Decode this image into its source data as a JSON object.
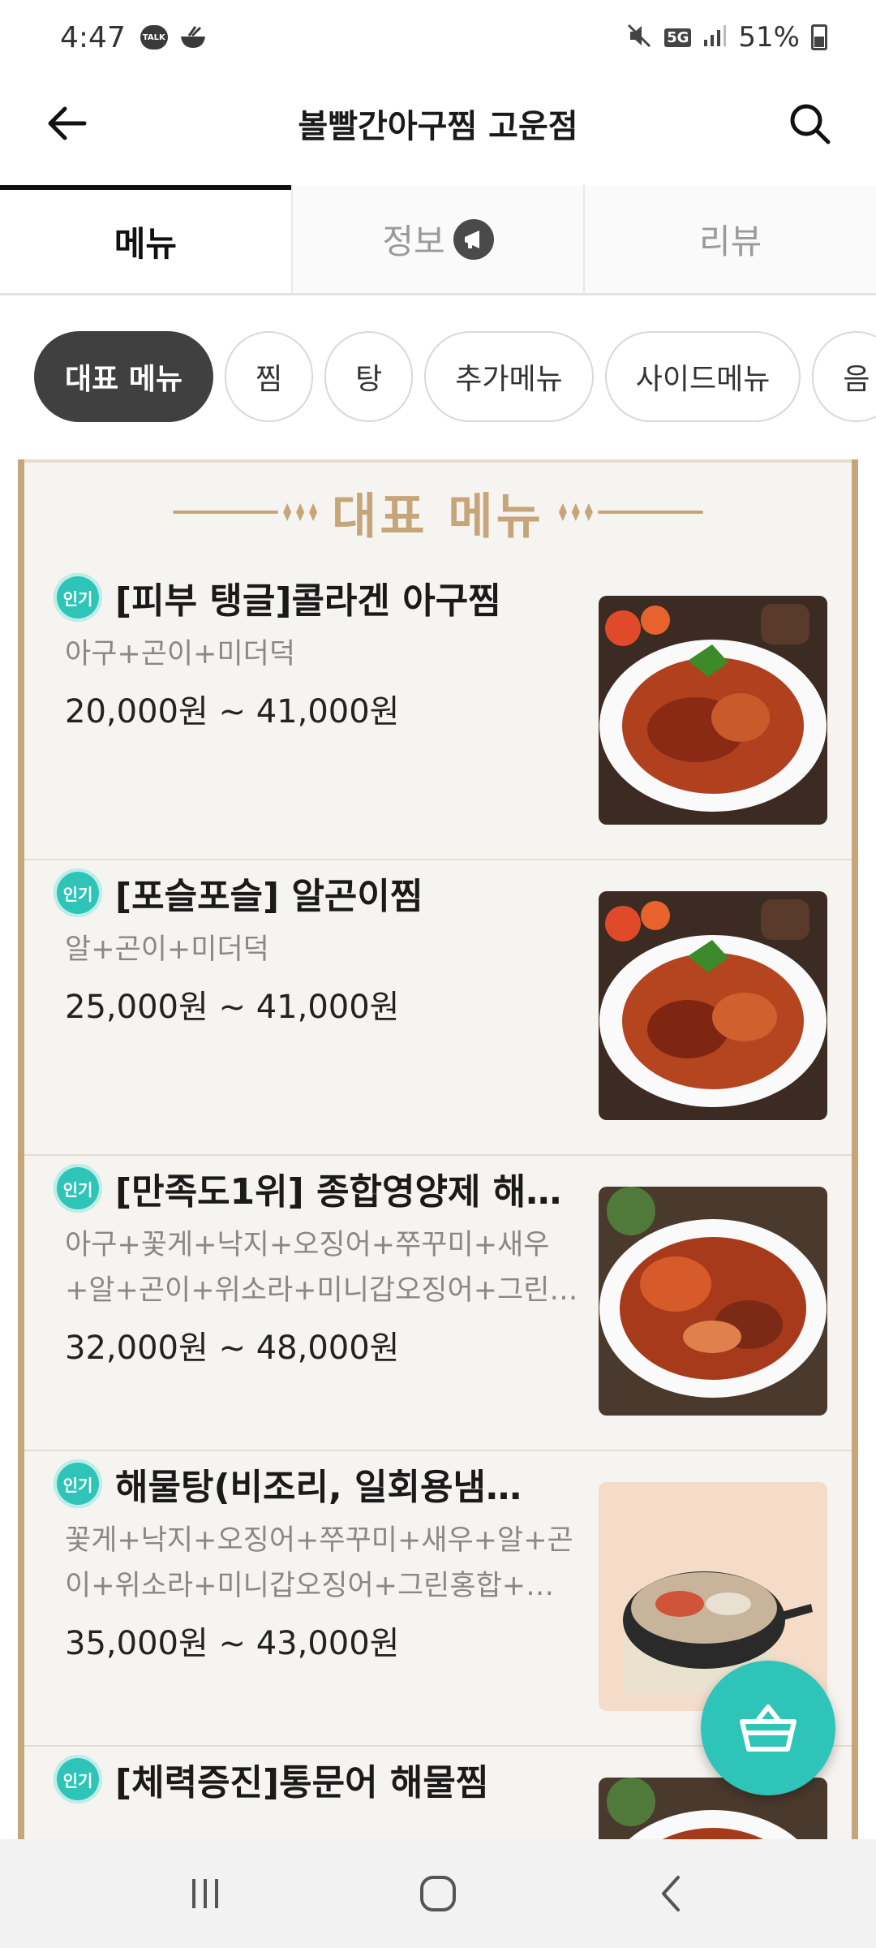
{
  "status_bar": {
    "time": "4:47",
    "talk_icon_text": "TALK",
    "battery_percent": "51%",
    "network": "5G"
  },
  "app_bar": {
    "title": "볼빨간아구찜 고운점"
  },
  "tabs": [
    {
      "label": "메뉴",
      "active": true
    },
    {
      "label": "정보",
      "active": false
    },
    {
      "label": "리뷰",
      "active": false
    }
  ],
  "chips": [
    {
      "label": "대표 메뉴",
      "active": true
    },
    {
      "label": "찜",
      "active": false
    },
    {
      "label": "탕",
      "active": false
    },
    {
      "label": "추가메뉴",
      "active": false
    },
    {
      "label": "사이드메뉴",
      "active": false
    },
    {
      "label": "음",
      "active": false
    }
  ],
  "section": {
    "title": "대표 메뉴"
  },
  "menu_items": [
    {
      "badge": "인기",
      "title": "[피부 탱글]콜라겐 아구찜",
      "desc": "아구+곤이+미더덕",
      "price": "20,000원 ~ 41,000원"
    },
    {
      "badge": "인기",
      "title": "[포슬포슬] 알곤이찜",
      "desc": "알+곤이+미더덕",
      "price": "25,000원 ~ 41,000원"
    },
    {
      "badge": "인기",
      "title": "[만족도1위] 종합영양제 해…",
      "desc": "아구+꽃게+낙지+오징어+쭈꾸미+새우+알+곤이+위소라+미니갑오징어+그린…",
      "price": "32,000원 ~ 48,000원"
    },
    {
      "badge": "인기",
      "title": "해물탕(비조리, 일회용냄…",
      "desc": "꽃게+낙지+오징어+쭈꾸미+새우+알+곤이+위소라+미니갑오징어+그린홍합+…",
      "price": "35,000원 ~ 43,000원"
    },
    {
      "badge": "인기",
      "title": "[체력증진]통문어 해물찜",
      "desc": "",
      "price": ""
    }
  ],
  "colors": {
    "accent": "#2ec4b8",
    "panel_border": "#c7a57a",
    "chip_active": "#404040"
  }
}
